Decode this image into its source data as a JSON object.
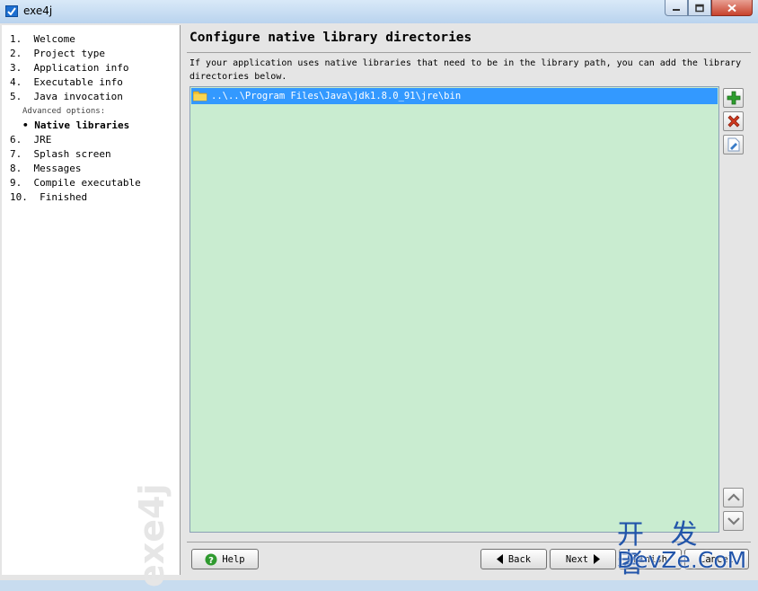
{
  "window": {
    "title": "exe4j"
  },
  "steps": [
    {
      "label": "1.  Welcome"
    },
    {
      "label": "2.  Project type"
    },
    {
      "label": "3.  Application info"
    },
    {
      "label": "4.  Executable info"
    },
    {
      "label": "5.  Java invocation"
    },
    {
      "label": "Advanced options:"
    },
    {
      "label": "• Native libraries"
    },
    {
      "label": "6.  JRE"
    },
    {
      "label": "7.  Splash screen"
    },
    {
      "label": "8.  Messages"
    },
    {
      "label": "9.  Compile executable"
    },
    {
      "label": "10.  Finished"
    }
  ],
  "sidebar_watermark": "exe4j",
  "main": {
    "title": "Configure native library directories",
    "description": "If your application uses native libraries that need to be in the library path, you can add the library directories below.",
    "directories": [
      {
        "path": "..\\..\\Program Files\\Java\\jdk1.8.0_91\\jre\\bin",
        "icon": "folder-icon",
        "selected": true
      }
    ],
    "side_buttons": [
      {
        "icon": "add-icon",
        "color": "#2e9e2e"
      },
      {
        "icon": "remove-icon",
        "color": "#d03a1f"
      },
      {
        "icon": "edit-icon",
        "color": "#3a7cc8"
      },
      {
        "icon": "move-up-icon",
        "color": "#7a7a7a"
      },
      {
        "icon": "move-down-icon",
        "color": "#7a7a7a"
      }
    ]
  },
  "buttons": {
    "help": "Help",
    "back": "Back",
    "next": "Next",
    "finish": "Finish",
    "cancel": "Cancel"
  },
  "overlay_watermark": {
    "chinese": "开 发 者",
    "english": "DevZe.CoM"
  },
  "colors": {
    "list_background": "#c9ecd0",
    "selection": "#3399ff",
    "watermark": "#2255aa"
  }
}
